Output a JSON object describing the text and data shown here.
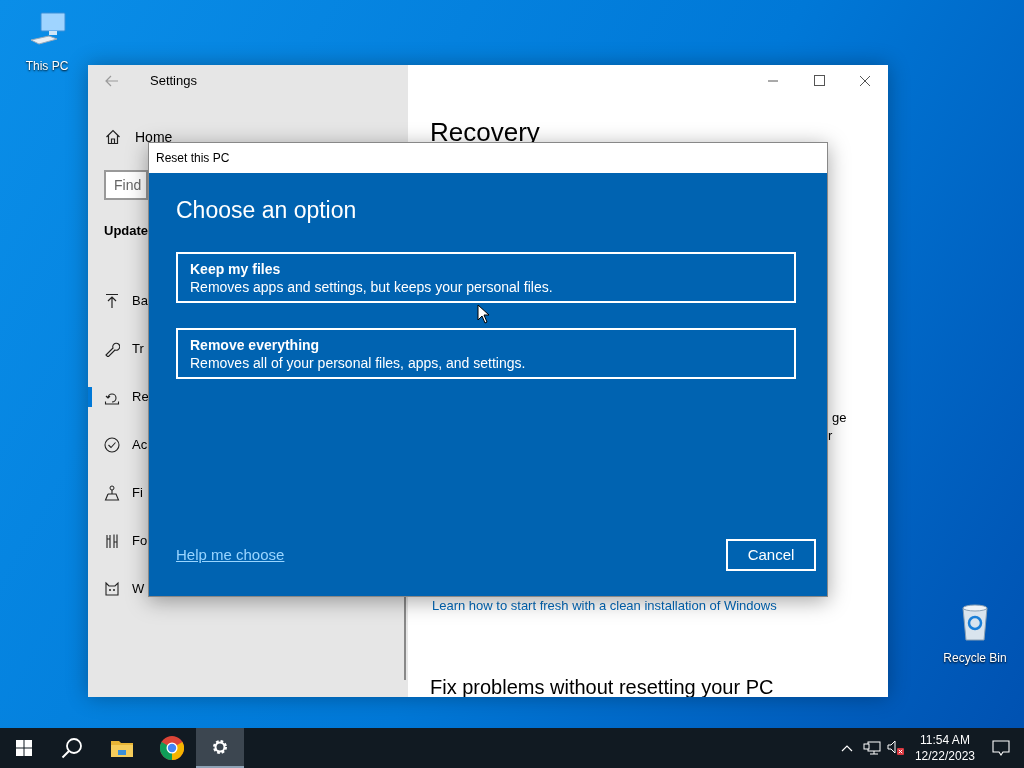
{
  "desktop_icons": [
    {
      "kind": "computer",
      "label": "This PC"
    },
    {
      "kind": "recycle-bin",
      "label": "Recycle Bin"
    }
  ],
  "settings_window": {
    "title": "Settings",
    "sidebar": {
      "home": "Home",
      "search_placeholder": "Find",
      "section": "Update",
      "items": [
        {
          "kind": "upload",
          "label": "Ba",
          "selected": false
        },
        {
          "kind": "wrench",
          "label": "Tr",
          "selected": false
        },
        {
          "kind": "recovery",
          "label": "Re",
          "selected": true
        },
        {
          "kind": "check",
          "label": "Ac",
          "selected": false
        },
        {
          "kind": "find",
          "label": "Fi",
          "selected": false
        },
        {
          "kind": "tools",
          "label": "Fo",
          "selected": false
        },
        {
          "kind": "cat",
          "label": "W",
          "selected": false
        }
      ]
    },
    "content": {
      "title": "Recovery",
      "fragments": [
        "ge",
        "r"
      ],
      "link": "Learn how to start fresh with a clean installation of Windows",
      "heading": "Fix problems without resetting your PC"
    }
  },
  "dialog": {
    "title": "Reset this PC",
    "heading": "Choose an option",
    "options": [
      {
        "title": "Keep my files",
        "description": "Removes apps and settings, but keeps your personal files."
      },
      {
        "title": "Remove everything",
        "description": "Removes all of your personal files, apps, and settings."
      }
    ],
    "help_link": "Help me choose",
    "cancel": "Cancel"
  },
  "taskbar": {
    "apps": [
      {
        "kind": "start",
        "active": false
      },
      {
        "kind": "search",
        "active": false
      },
      {
        "kind": "folder",
        "active": false
      },
      {
        "kind": "browser",
        "active": false
      },
      {
        "kind": "settings",
        "active": true
      }
    ],
    "clock": {
      "time": "11:54 AM",
      "date": "12/22/2023"
    }
  }
}
